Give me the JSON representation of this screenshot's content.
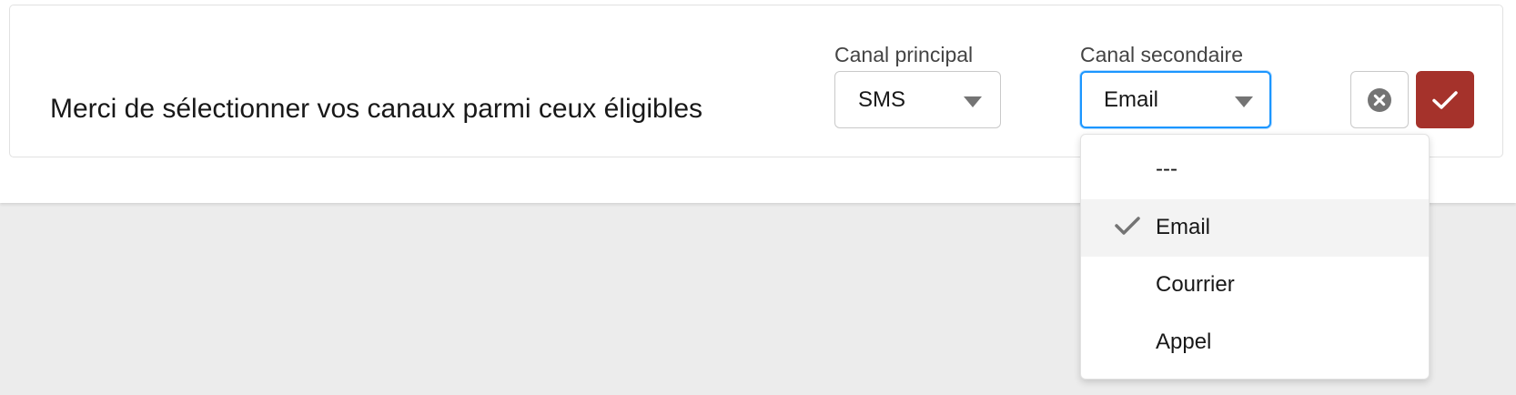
{
  "prompt": {
    "message": "Merci de sélectionner vos canaux parmi ceux éligibles"
  },
  "fields": {
    "primary": {
      "label": "Canal principal",
      "value": "SMS"
    },
    "secondary": {
      "label": "Canal secondaire",
      "value": "Email"
    }
  },
  "dropdown": {
    "options": [
      {
        "label": "---",
        "selected": false
      },
      {
        "label": "Email",
        "selected": true
      },
      {
        "label": "Courrier",
        "selected": false
      },
      {
        "label": "Appel",
        "selected": false
      }
    ]
  },
  "actions": {
    "cancel_icon": "close-circle-icon",
    "confirm_icon": "checkmark-icon"
  },
  "colors": {
    "page_background": "#ececec",
    "panel_background": "#ffffff",
    "focus_border": "#1b96ff",
    "confirm_button": "#a5322b",
    "selected_option": "#f3f3f3",
    "icon_grey": "#747474"
  }
}
